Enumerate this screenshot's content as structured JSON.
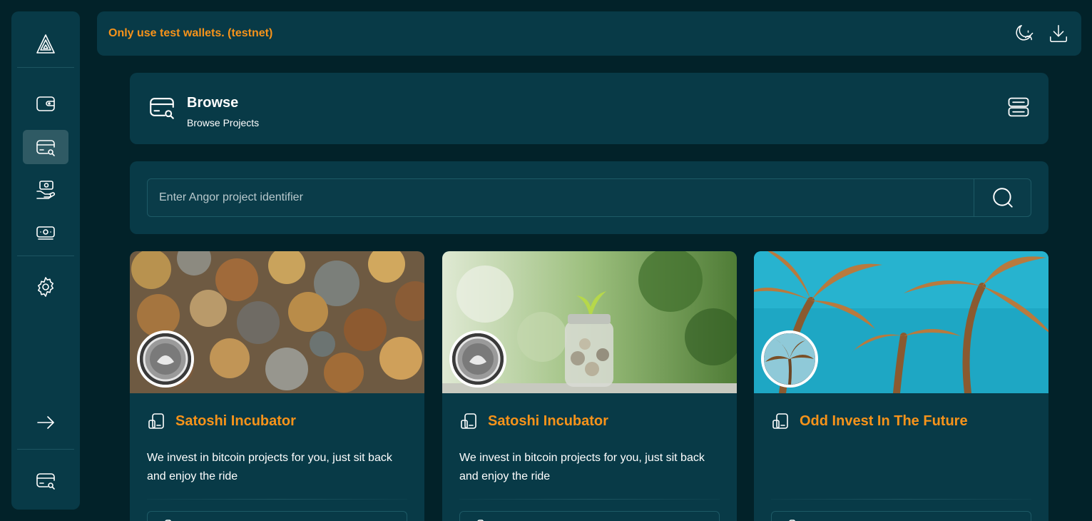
{
  "topbar": {
    "warning": "Only use test wallets. (testnet)",
    "theme_icon": "moon-sun-icon",
    "install_icon": "download-icon"
  },
  "sidebar": {
    "items": [
      {
        "icon": "angor-logo-icon"
      },
      {
        "icon": "wallet-icon"
      },
      {
        "icon": "browse-icon",
        "active": true
      },
      {
        "icon": "hand-money-icon"
      },
      {
        "icon": "money-stack-icon"
      },
      {
        "icon": "gear-icon"
      },
      {
        "icon": "arrow-right-icon"
      },
      {
        "icon": "browse-icon"
      }
    ]
  },
  "header": {
    "title": "Browse",
    "subtitle": "Browse Projects",
    "view_icon": "server-list-icon"
  },
  "search": {
    "placeholder": "Enter Angor project identifier",
    "value": "",
    "button_icon": "search-icon"
  },
  "projects": [
    {
      "title": "Satoshi Incubator",
      "description": "We invest in bitcoin projects for you, just sit back and enjoy the ride",
      "banner": "coins",
      "avatar": "coin-avatar"
    },
    {
      "title": "Satoshi Incubator",
      "description": "We invest in bitcoin projects for you, just sit back and enjoy the ride",
      "banner": "jar",
      "avatar": "coin-avatar"
    },
    {
      "title": "Odd Invest In The Future",
      "description": "",
      "banner": "palms",
      "avatar": "palm-avatar"
    }
  ],
  "colors": {
    "background": "#022229",
    "panel": "#083a47",
    "accent": "#f7931a",
    "active": "#2f5a64"
  }
}
